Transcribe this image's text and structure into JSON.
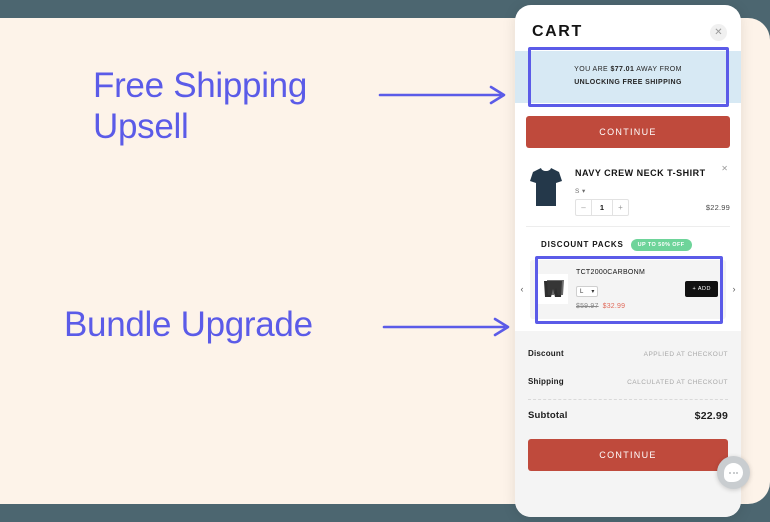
{
  "annotations": [
    {
      "id": "free-shipping",
      "label": "Free Shipping\nUpsell",
      "arrow": "arrow-right-icon"
    },
    {
      "id": "bundle-upgrade",
      "label": "Bundle Upgrade",
      "arrow": "arrow-right-icon"
    }
  ],
  "colors": {
    "page_background": "#4c6670",
    "slide_background": "#fdf3e9",
    "annotation_accent": "#5b5be8",
    "highlight_box": "#5b5be8",
    "cta_red": "#bf4a3c",
    "shipping_bar": "#d7e9f4",
    "badge_green": "#6ed49a",
    "sale_price": "#e06a5a"
  },
  "cart": {
    "title": "CART",
    "close_icon": "close-icon",
    "free_shipping": {
      "line1_prefix": "YOU ARE ",
      "amount": "$77.01",
      "line1_suffix": " AWAY FROM",
      "line2": "UNLOCKING FREE SHIPPING"
    },
    "continue_top_label": "CONTINUE",
    "continue_bottom_label": "CONTINUE",
    "line_item": {
      "thumb_icon": "navy-tshirt-image",
      "title": "NAVY CREW NECK T-SHIRT",
      "variant": "S",
      "variant_caret": "chevron-down-icon",
      "decrement": "–",
      "quantity": "1",
      "increment": "+",
      "price": "$22.99",
      "remove_icon": "close-icon"
    },
    "discount_packs": {
      "title": "DISCOUNT PACKS",
      "badge": "UP TO 50% OFF",
      "prev_icon": "chevron-left-icon",
      "next_icon": "chevron-right-icon",
      "card": {
        "thumb_icon": "carbon-shorts-image",
        "title": "TCT2000CARBONM",
        "size_value": "L",
        "size_caret": "chevron-down-icon",
        "old_price": "$59.97",
        "new_price": "$32.99",
        "add_label": "+ ADD"
      }
    },
    "summary": {
      "rows": [
        {
          "label": "Discount",
          "value": "APPLIED AT CHECKOUT"
        },
        {
          "label": "Shipping",
          "value": "CALCULATED AT CHECKOUT"
        }
      ],
      "subtotal_label": "Subtotal",
      "subtotal_value": "$22.99"
    }
  },
  "chat_widget": {
    "icon": "chat-bubble-icon"
  }
}
